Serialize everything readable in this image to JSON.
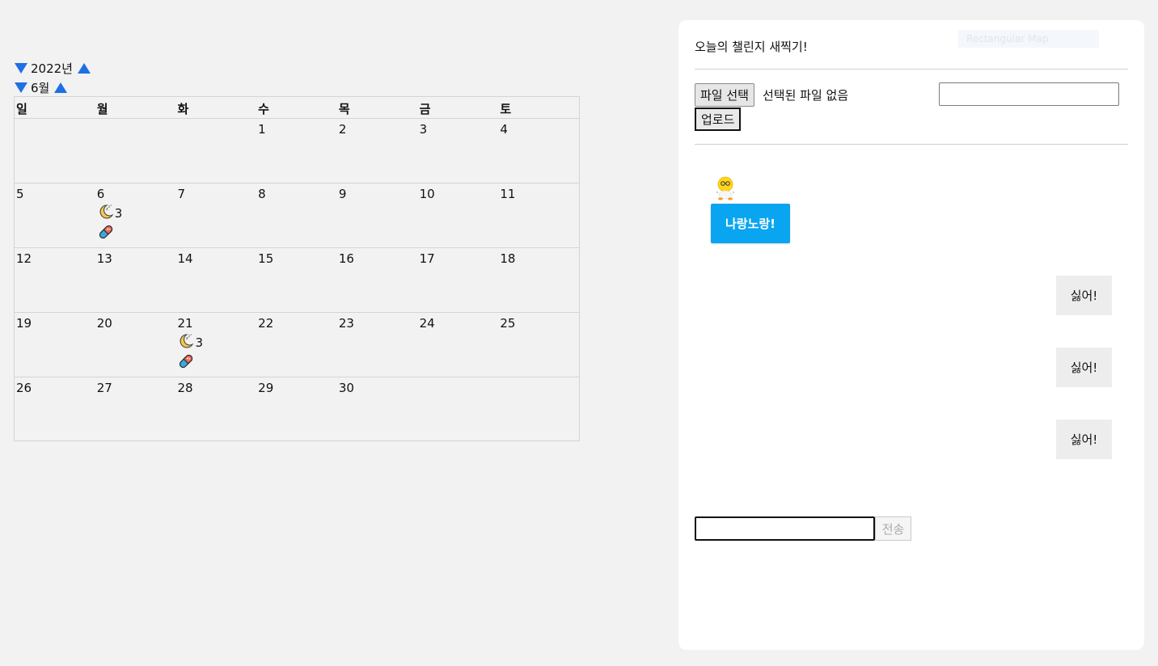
{
  "calendar": {
    "year_label": "2022년",
    "month_label": "6월",
    "weekdays": [
      "일",
      "월",
      "화",
      "수",
      "목",
      "금",
      "토"
    ],
    "weeks": [
      [
        {
          "day": ""
        },
        {
          "day": ""
        },
        {
          "day": ""
        },
        {
          "day": "1"
        },
        {
          "day": "2"
        },
        {
          "day": "3"
        },
        {
          "day": "4"
        }
      ],
      [
        {
          "day": "5"
        },
        {
          "day": "6",
          "sleep": "3",
          "pill": true
        },
        {
          "day": "7"
        },
        {
          "day": "8"
        },
        {
          "day": "9"
        },
        {
          "day": "10"
        },
        {
          "day": "11"
        }
      ],
      [
        {
          "day": "12"
        },
        {
          "day": "13"
        },
        {
          "day": "14"
        },
        {
          "day": "15"
        },
        {
          "day": "16"
        },
        {
          "day": "17"
        },
        {
          "day": "18"
        }
      ],
      [
        {
          "day": "19"
        },
        {
          "day": "20"
        },
        {
          "day": "21",
          "sleep": "3",
          "pill": true
        },
        {
          "day": "22"
        },
        {
          "day": "23"
        },
        {
          "day": "24"
        },
        {
          "day": "25"
        }
      ],
      [
        {
          "day": "26"
        },
        {
          "day": "27"
        },
        {
          "day": "28"
        },
        {
          "day": "29"
        },
        {
          "day": "30"
        },
        {
          "day": ""
        },
        {
          "day": ""
        }
      ]
    ]
  },
  "panel": {
    "title": "오늘의 챌린지 새찍기!",
    "ghost_tag": "Rectangular Map",
    "file_button": "파일 선택",
    "file_status": "선택된 파일 없음",
    "upload_button": "업로드",
    "bot_message": "나랑노랑!",
    "user_messages": [
      "싫어!",
      "싫어!",
      "싫어!"
    ],
    "send_button": "전송"
  },
  "colors": {
    "accent": "#1f6fe5",
    "bubble_bot": "#0aa5f0",
    "bubble_user": "#ededed"
  }
}
